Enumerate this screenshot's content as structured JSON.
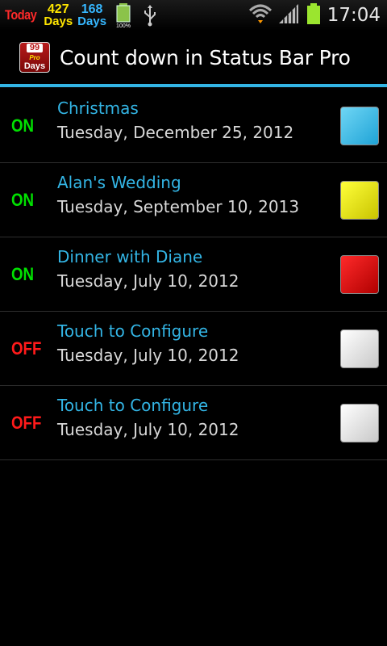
{
  "statusbar": {
    "today_label": "Today",
    "counters": [
      {
        "number": "427",
        "unit": "Days",
        "color": "#ffe600"
      },
      {
        "number": "168",
        "unit": "Days",
        "color": "#36b7ff"
      }
    ],
    "battery_small_label": "100%",
    "time": "17:04"
  },
  "app": {
    "icon_number": "99",
    "icon_sub": "Pro",
    "icon_unit": "Days",
    "title": "Count down in Status Bar Pro",
    "accent_color": "#33b5e5"
  },
  "events": [
    {
      "state": "ON",
      "name": "Christmas",
      "date": "Tuesday, December 25, 2012",
      "color": "#3bbfe8"
    },
    {
      "state": "ON",
      "name": "Alan's Wedding",
      "date": "Tuesday, September 10, 2013",
      "color": "#f2ee00"
    },
    {
      "state": "ON",
      "name": "Dinner with Diane",
      "date": "Tuesday, July 10, 2012",
      "color": "#e00000"
    },
    {
      "state": "OFF",
      "name": "Touch to Configure",
      "date": "Tuesday, July 10, 2012",
      "color": "#f4f4f4"
    },
    {
      "state": "OFF",
      "name": "Touch to Configure",
      "date": "Tuesday, July 10, 2012",
      "color": "#f4f4f4"
    }
  ]
}
